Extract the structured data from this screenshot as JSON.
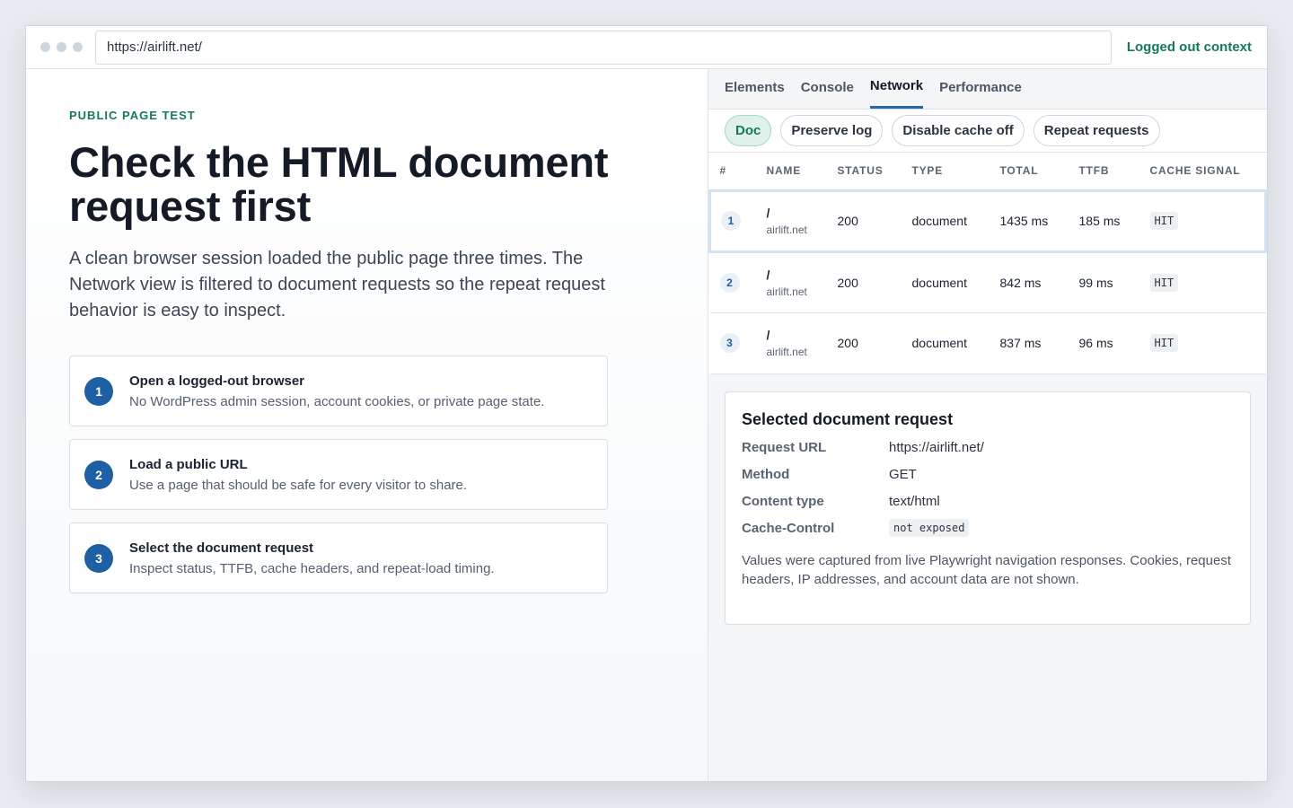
{
  "browser": {
    "url": "https://airlift.net/",
    "context_label": "Logged out context"
  },
  "left": {
    "eyebrow": "PUBLIC PAGE TEST",
    "headline": "Check the HTML document request first",
    "intro": "A clean browser session loaded the public page three times. The Network view is filtered to document requests so the repeat request behavior is easy to inspect.",
    "steps": [
      {
        "num": "1",
        "title": "Open a logged-out browser",
        "desc": "No WordPress admin session, account cookies, or private page state."
      },
      {
        "num": "2",
        "title": "Load a public URL",
        "desc": "Use a page that should be safe for every visitor to share."
      },
      {
        "num": "3",
        "title": "Select the document request",
        "desc": "Inspect status, TTFB, cache headers, and repeat-load timing."
      }
    ]
  },
  "devtools": {
    "tabs": [
      "Elements",
      "Console",
      "Network",
      "Performance"
    ],
    "active_tab": "Network",
    "chips": [
      "Doc",
      "Preserve log",
      "Disable cache off",
      "Repeat requests"
    ],
    "active_chip": "Doc",
    "columns": [
      "#",
      "NAME",
      "STATUS",
      "TYPE",
      "TOTAL",
      "TTFB",
      "CACHE SIGNAL"
    ],
    "rows": [
      {
        "num": "1",
        "name": "/",
        "host": "airlift.net",
        "status": "200",
        "type": "document",
        "total": "1435 ms",
        "ttfb": "185 ms",
        "cache": "HIT"
      },
      {
        "num": "2",
        "name": "/",
        "host": "airlift.net",
        "status": "200",
        "type": "document",
        "total": "842 ms",
        "ttfb": "99 ms",
        "cache": "HIT"
      },
      {
        "num": "3",
        "name": "/",
        "host": "airlift.net",
        "status": "200",
        "type": "document",
        "total": "837 ms",
        "ttfb": "96 ms",
        "cache": "HIT"
      }
    ],
    "selected_row": 0
  },
  "detail": {
    "title": "Selected document request",
    "fields": [
      {
        "key": "Request URL",
        "value": "https://airlift.net/"
      },
      {
        "key": "Method",
        "value": "GET"
      },
      {
        "key": "Content type",
        "value": "text/html"
      },
      {
        "key": "Cache-Control",
        "value": "not exposed"
      }
    ],
    "note": "Values were captured from live Playwright navigation responses. Cookies, request headers, IP addresses, and account data are not shown."
  }
}
